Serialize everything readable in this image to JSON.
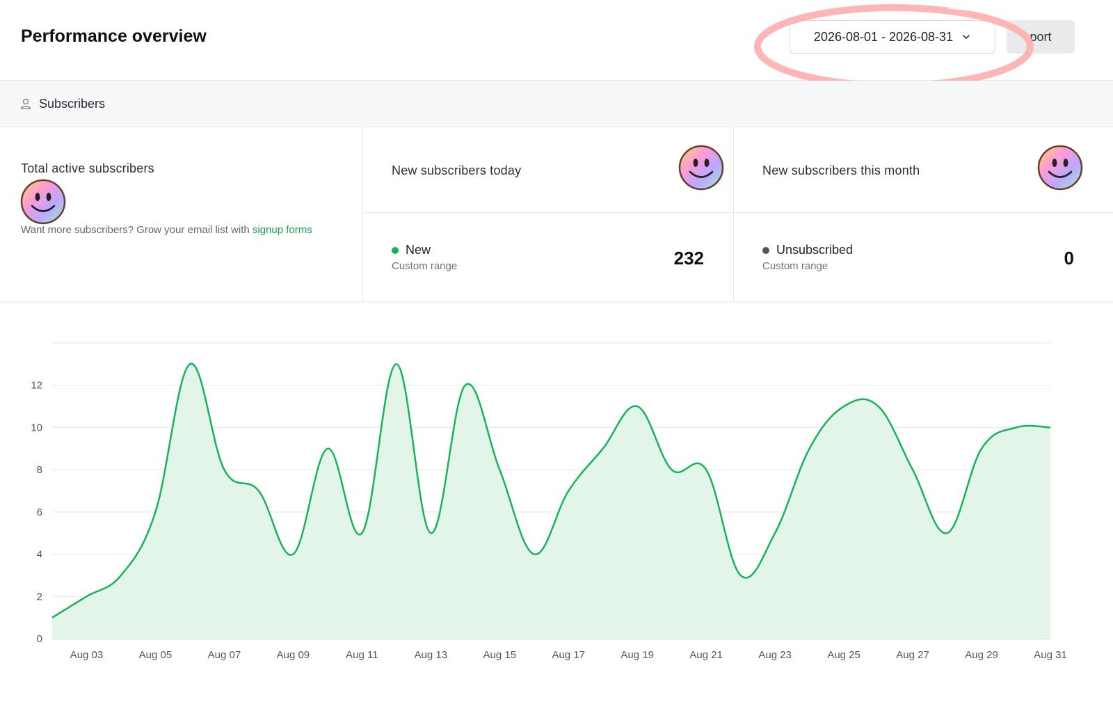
{
  "header": {
    "title": "Performance overview",
    "date_range": "2026-08-01 - 2026-08-31",
    "export_label": "port"
  },
  "section": {
    "icon": "user-icon",
    "label": "Subscribers"
  },
  "stats": {
    "total": {
      "title": "Total active subscribers",
      "hint_prefix": "Want more subscribers? Grow your email list with",
      "hint_link": "signup forms"
    },
    "today": {
      "title": "New subscribers today",
      "metric_label": "New",
      "metric_sub": "Custom range",
      "metric_value": "232",
      "dot_color": "#16b35a"
    },
    "month": {
      "title": "New subscribers this month",
      "metric_label": "Unsubscribed",
      "metric_sub": "Custom range",
      "metric_value": "0",
      "dot_color": "#555555"
    }
  },
  "colors": {
    "accent": "#16b35a",
    "area_fill": "#e2f5e8",
    "highlight_ring": "#fdb2b2"
  },
  "chart_data": {
    "type": "area",
    "x": [
      "Aug 02",
      "Aug 03",
      "Aug 04",
      "Aug 05",
      "Aug 06",
      "Aug 07",
      "Aug 08",
      "Aug 09",
      "Aug 10",
      "Aug 11",
      "Aug 12",
      "Aug 13",
      "Aug 14",
      "Aug 15",
      "Aug 16",
      "Aug 17",
      "Aug 18",
      "Aug 19",
      "Aug 20",
      "Aug 21",
      "Aug 22",
      "Aug 23",
      "Aug 24",
      "Aug 25",
      "Aug 26",
      "Aug 27",
      "Aug 28",
      "Aug 29",
      "Aug 30",
      "Aug 31"
    ],
    "values": [
      1,
      2,
      3,
      6,
      13,
      8,
      7,
      4,
      9,
      5,
      13,
      5,
      12,
      8,
      4,
      7,
      9,
      11,
      8,
      8,
      3,
      5,
      9,
      11,
      11,
      8,
      5,
      9,
      10,
      10
    ],
    "x_tick_labels": [
      "Aug 03",
      "Aug 05",
      "Aug 07",
      "Aug 09",
      "Aug 11",
      "Aug 13",
      "Aug 15",
      "Aug 17",
      "Aug 19",
      "Aug 21",
      "Aug 23",
      "Aug 25",
      "Aug 27",
      "Aug 29",
      "Aug 31"
    ],
    "y_ticks": [
      0,
      2,
      4,
      6,
      8,
      10,
      12
    ],
    "ylim": [
      0,
      14
    ],
    "grid": true,
    "title": "",
    "xlabel": "",
    "ylabel": ""
  }
}
